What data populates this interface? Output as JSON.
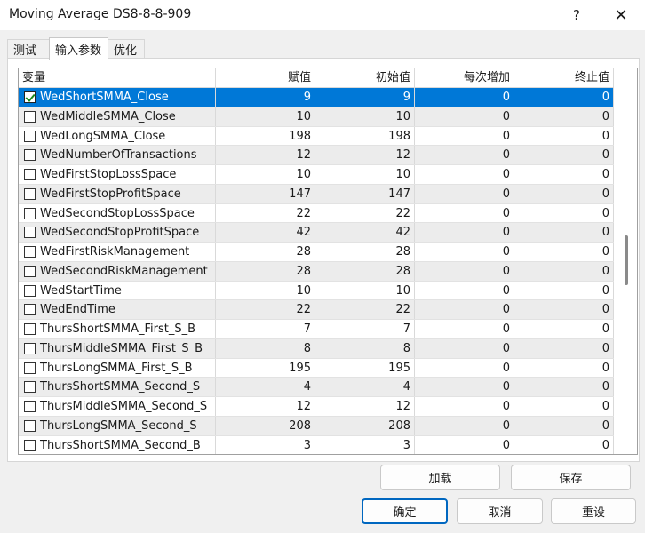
{
  "window": {
    "title": "Moving Average DS8-8-8-909",
    "help": "?",
    "close": "✕"
  },
  "tabs": [
    {
      "label": "测试"
    },
    {
      "label": "输入参数"
    },
    {
      "label": "优化"
    }
  ],
  "grid": {
    "columns": [
      "变量",
      "赋值",
      "初始值",
      "每次增加",
      "终止值"
    ],
    "rows": [
      {
        "name": "WedShortSMMA_Close",
        "value": "9",
        "initial": "9",
        "step": "0",
        "end": "0",
        "checked": true,
        "selected": true
      },
      {
        "name": "WedMiddleSMMA_Close",
        "value": "10",
        "initial": "10",
        "step": "0",
        "end": "0",
        "checked": false
      },
      {
        "name": "WedLongSMMA_Close",
        "value": "198",
        "initial": "198",
        "step": "0",
        "end": "0",
        "checked": false
      },
      {
        "name": "WedNumberOfTransactions",
        "value": "12",
        "initial": "12",
        "step": "0",
        "end": "0",
        "checked": false
      },
      {
        "name": "WedFirstStopLossSpace",
        "value": "10",
        "initial": "10",
        "step": "0",
        "end": "0",
        "checked": false
      },
      {
        "name": "WedFirstStopProfitSpace",
        "value": "147",
        "initial": "147",
        "step": "0",
        "end": "0",
        "checked": false
      },
      {
        "name": "WedSecondStopLossSpace",
        "value": "22",
        "initial": "22",
        "step": "0",
        "end": "0",
        "checked": false
      },
      {
        "name": "WedSecondStopProfitSpace",
        "value": "42",
        "initial": "42",
        "step": "0",
        "end": "0",
        "checked": false
      },
      {
        "name": "WedFirstRiskManagement",
        "value": "28",
        "initial": "28",
        "step": "0",
        "end": "0",
        "checked": false
      },
      {
        "name": "WedSecondRiskManagement",
        "value": "28",
        "initial": "28",
        "step": "0",
        "end": "0",
        "checked": false
      },
      {
        "name": "WedStartTime",
        "value": "10",
        "initial": "10",
        "step": "0",
        "end": "0",
        "checked": false
      },
      {
        "name": "WedEndTime",
        "value": "22",
        "initial": "22",
        "step": "0",
        "end": "0",
        "checked": false
      },
      {
        "name": "ThursShortSMMA_First_S_B",
        "value": "7",
        "initial": "7",
        "step": "0",
        "end": "0",
        "checked": false
      },
      {
        "name": "ThursMiddleSMMA_First_S_B",
        "value": "8",
        "initial": "8",
        "step": "0",
        "end": "0",
        "checked": false
      },
      {
        "name": "ThursLongSMMA_First_S_B",
        "value": "195",
        "initial": "195",
        "step": "0",
        "end": "0",
        "checked": false
      },
      {
        "name": "ThursShortSMMA_Second_S",
        "value": "4",
        "initial": "4",
        "step": "0",
        "end": "0",
        "checked": false
      },
      {
        "name": "ThursMiddleSMMA_Second_S",
        "value": "12",
        "initial": "12",
        "step": "0",
        "end": "0",
        "checked": false
      },
      {
        "name": "ThursLongSMMA_Second_S",
        "value": "208",
        "initial": "208",
        "step": "0",
        "end": "0",
        "checked": false
      },
      {
        "name": "ThursShortSMMA_Second_B",
        "value": "3",
        "initial": "3",
        "step": "0",
        "end": "0",
        "checked": false
      }
    ]
  },
  "buttons": {
    "load": "加载",
    "save": "保存",
    "ok": "确定",
    "cancel": "取消",
    "reset": "重设"
  },
  "colors": {
    "selection": "#0078d7",
    "primary_border": "#0067c0",
    "checkmark": "#1b8a1b"
  }
}
